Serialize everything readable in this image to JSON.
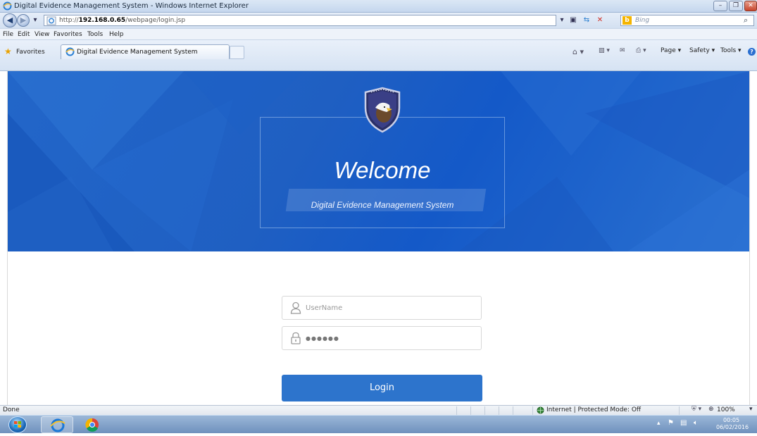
{
  "window": {
    "title": "Digital Evidence Management System - Windows Internet Explorer",
    "controls": [
      "minimize",
      "maximize",
      "close"
    ]
  },
  "address_bar": {
    "url_prefix": "http://",
    "url_host": "192.168.0.65",
    "url_path": "/webpage/login.jsp",
    "search_placeholder": "Bing",
    "icons": [
      "back-icon",
      "forward-icon",
      "dropdown-arrow-icon",
      "page-icon",
      "compatibility-view-icon",
      "refresh-icon",
      "stop-icon",
      "bing-icon",
      "search-icon"
    ]
  },
  "menu_bar": {
    "items": [
      "File",
      "Edit",
      "View",
      "Favorites",
      "Tools",
      "Help"
    ]
  },
  "favorites_bar": {
    "favorites_label": "Favorites",
    "tab_title": "Digital Evidence Management System",
    "commands": [
      "Page ▾",
      "Safety ▾",
      "Tools ▾"
    ]
  },
  "page": {
    "welcome": "Welcome",
    "subtitle": "Digital Evidence Management System",
    "username_placeholder": "UserName",
    "password_value": "●●●●●●",
    "login_label": "Login",
    "accent_color": "#2d74cc",
    "banner_color": "#1f5fc2"
  },
  "status_bar": {
    "status": "Done",
    "zone": "Internet | Protected Mode: Off",
    "zoom": "100%"
  },
  "taskbar": {
    "time": "00:05",
    "date": "06/02/2016",
    "apps": [
      "internet-explorer",
      "chrome"
    ]
  }
}
